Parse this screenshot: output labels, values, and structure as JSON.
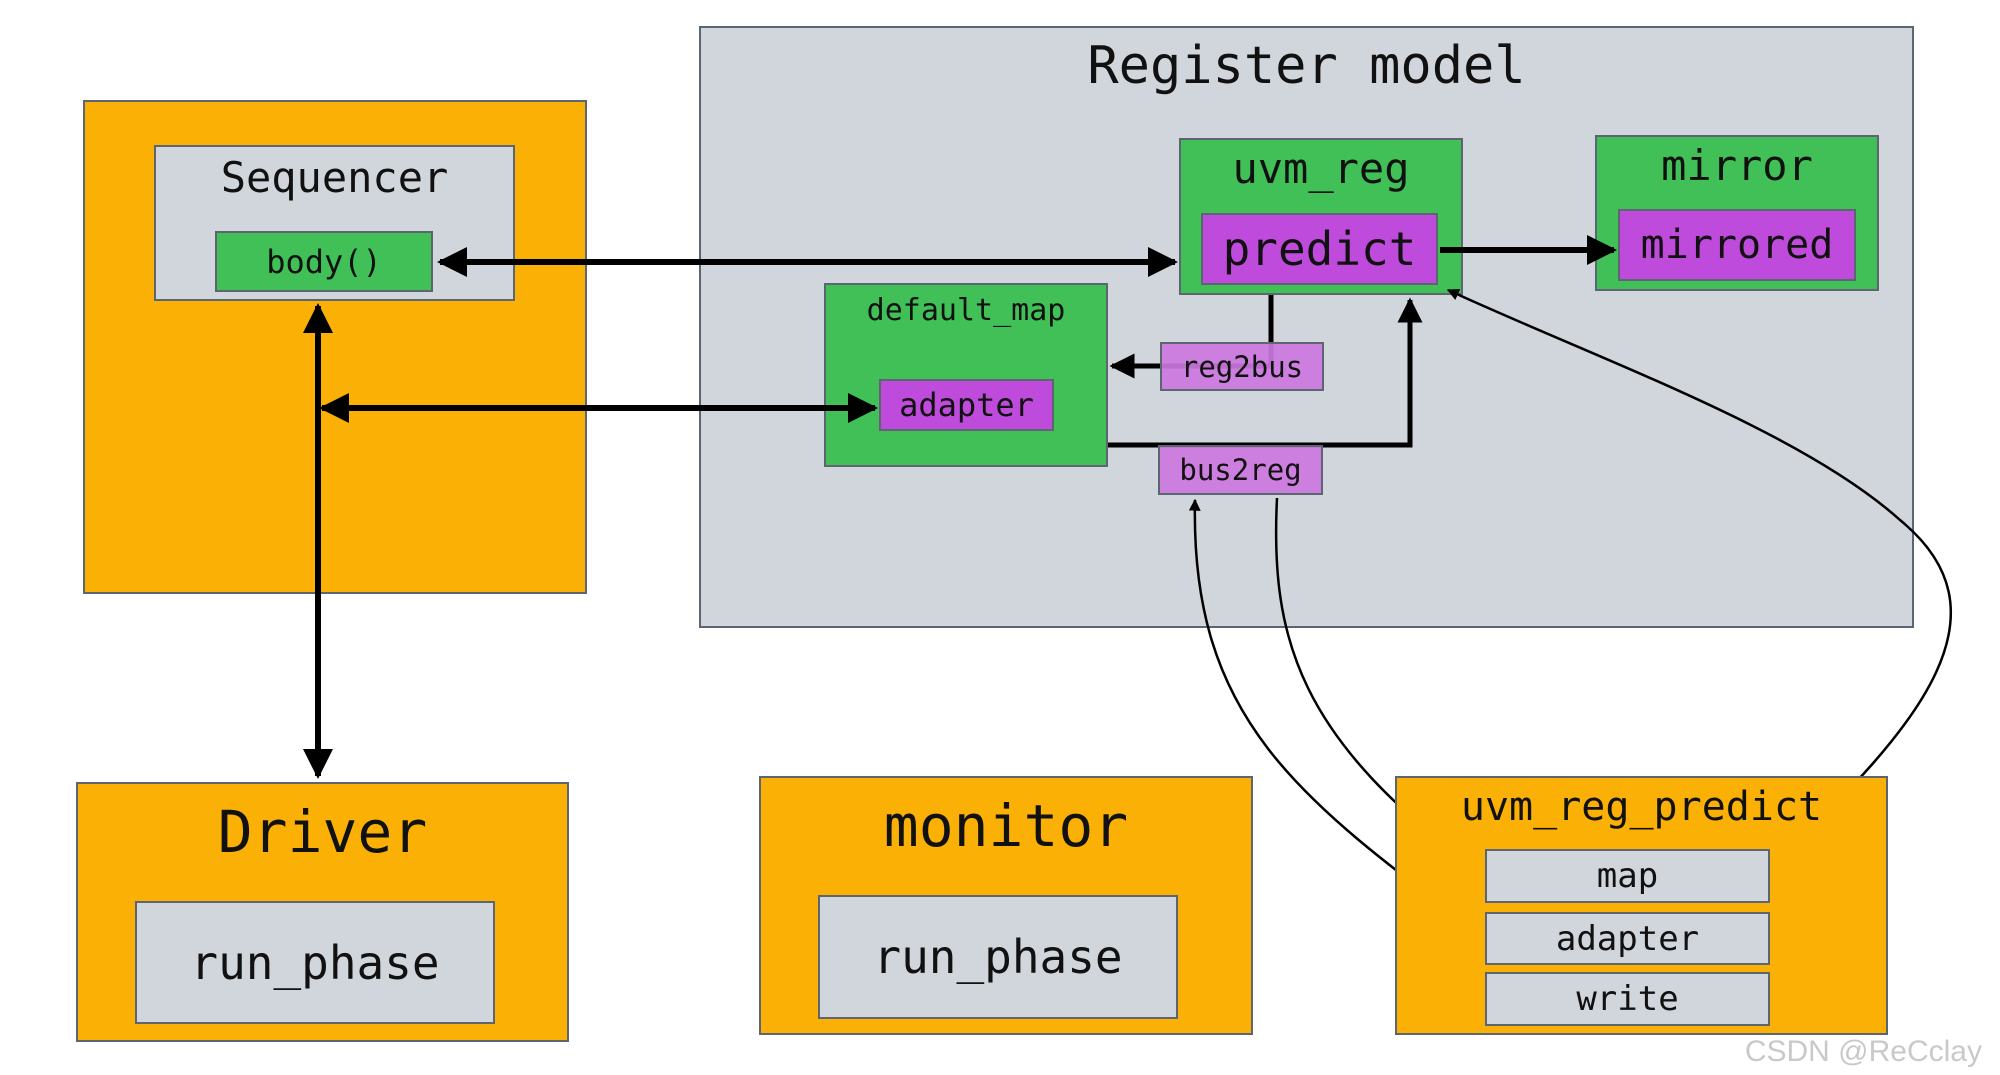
{
  "diagram": {
    "sequencer": {
      "title": "Sequencer",
      "body": "body()"
    },
    "register_model": {
      "title": "Register model",
      "uvm_reg": {
        "title": "uvm_reg",
        "predict": "predict"
      },
      "mirror": {
        "title": "mirror",
        "mirrored": "mirrored"
      },
      "default_map": {
        "title": "default_map",
        "adapter": "adapter"
      },
      "reg2bus": "reg2bus",
      "bus2reg": "bus2reg"
    },
    "driver": {
      "title": "Driver",
      "run_phase": "run_phase"
    },
    "monitor": {
      "title": "monitor",
      "run_phase": "run_phase"
    },
    "predictor": {
      "title": "uvm_reg_predict",
      "map": "map",
      "adapter": "adapter",
      "write": "write"
    },
    "colors": {
      "component": "#fab005",
      "container": "#d1d5dc",
      "object": "#40c057",
      "method": "#be4bdb"
    }
  },
  "watermark": "CSDN @ReCclay"
}
